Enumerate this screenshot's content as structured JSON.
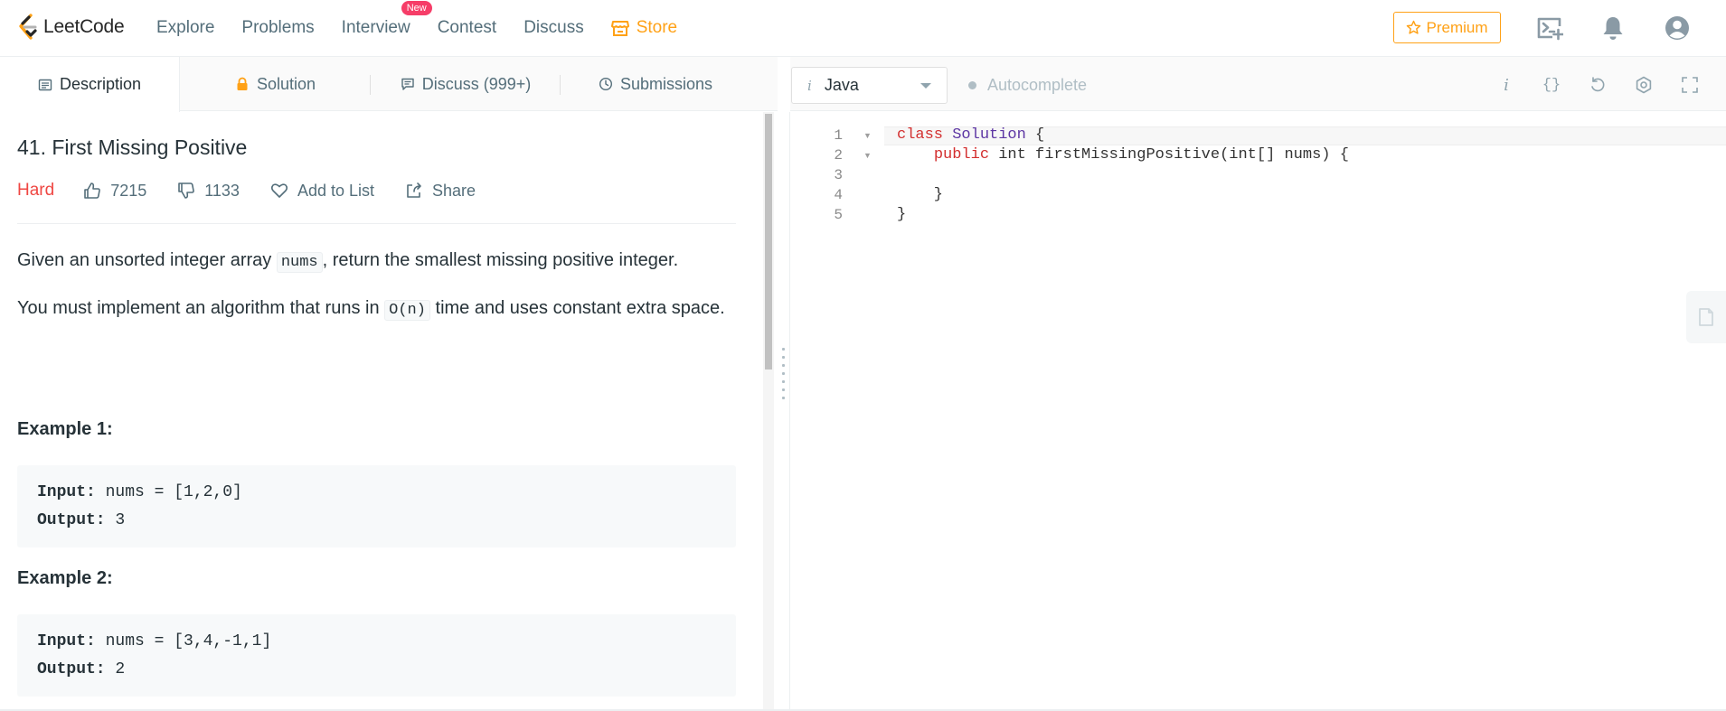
{
  "nav": {
    "brand": "LeetCode",
    "links": [
      "Explore",
      "Problems",
      "Interview",
      "Contest",
      "Discuss"
    ],
    "new_badge": "New",
    "store": "Store",
    "premium": "Premium",
    "brand_color": "#ffa116"
  },
  "tabs": {
    "description": "Description",
    "solution": "Solution",
    "discuss": "Discuss (999+)",
    "submissions": "Submissions"
  },
  "problem": {
    "title": "41. First Missing Positive",
    "difficulty": "Hard",
    "likes": "7215",
    "dislikes": "1133",
    "add_to_list": "Add to List",
    "share": "Share",
    "p1_before": "Given an unsorted integer array ",
    "p1_code": "nums",
    "p1_after": ", return the smallest missing positive integer.",
    "p2_before": "You must implement an algorithm that runs in ",
    "p2_code": "O(n)",
    "p2_after": " time and uses constant extra space.",
    "examples": [
      {
        "heading": "Example 1:",
        "input_label": "Input:",
        "input": " nums = [1,2,0]",
        "output_label": "Output:",
        "output": " 3"
      },
      {
        "heading": "Example 2:",
        "input_label": "Input:",
        "input": " nums = [3,4,-1,1]",
        "output_label": "Output:",
        "output": " 2"
      }
    ]
  },
  "editor": {
    "language": "Java",
    "language_icon": "i",
    "autocomplete": "Autocomplete",
    "settings_icon": "i",
    "format_icon": "{}",
    "line_numbers": [
      "1",
      "2",
      "3",
      "4",
      "5"
    ],
    "code": {
      "l1_kw": "class",
      "l1_cls": "Solution",
      "l1_rest": " {",
      "l2_indent": "    ",
      "l2_kw": "public",
      "l2_rest": " int firstMissingPositive(int[] nums) {",
      "l3": "",
      "l4": "    }",
      "l5": "}"
    }
  }
}
